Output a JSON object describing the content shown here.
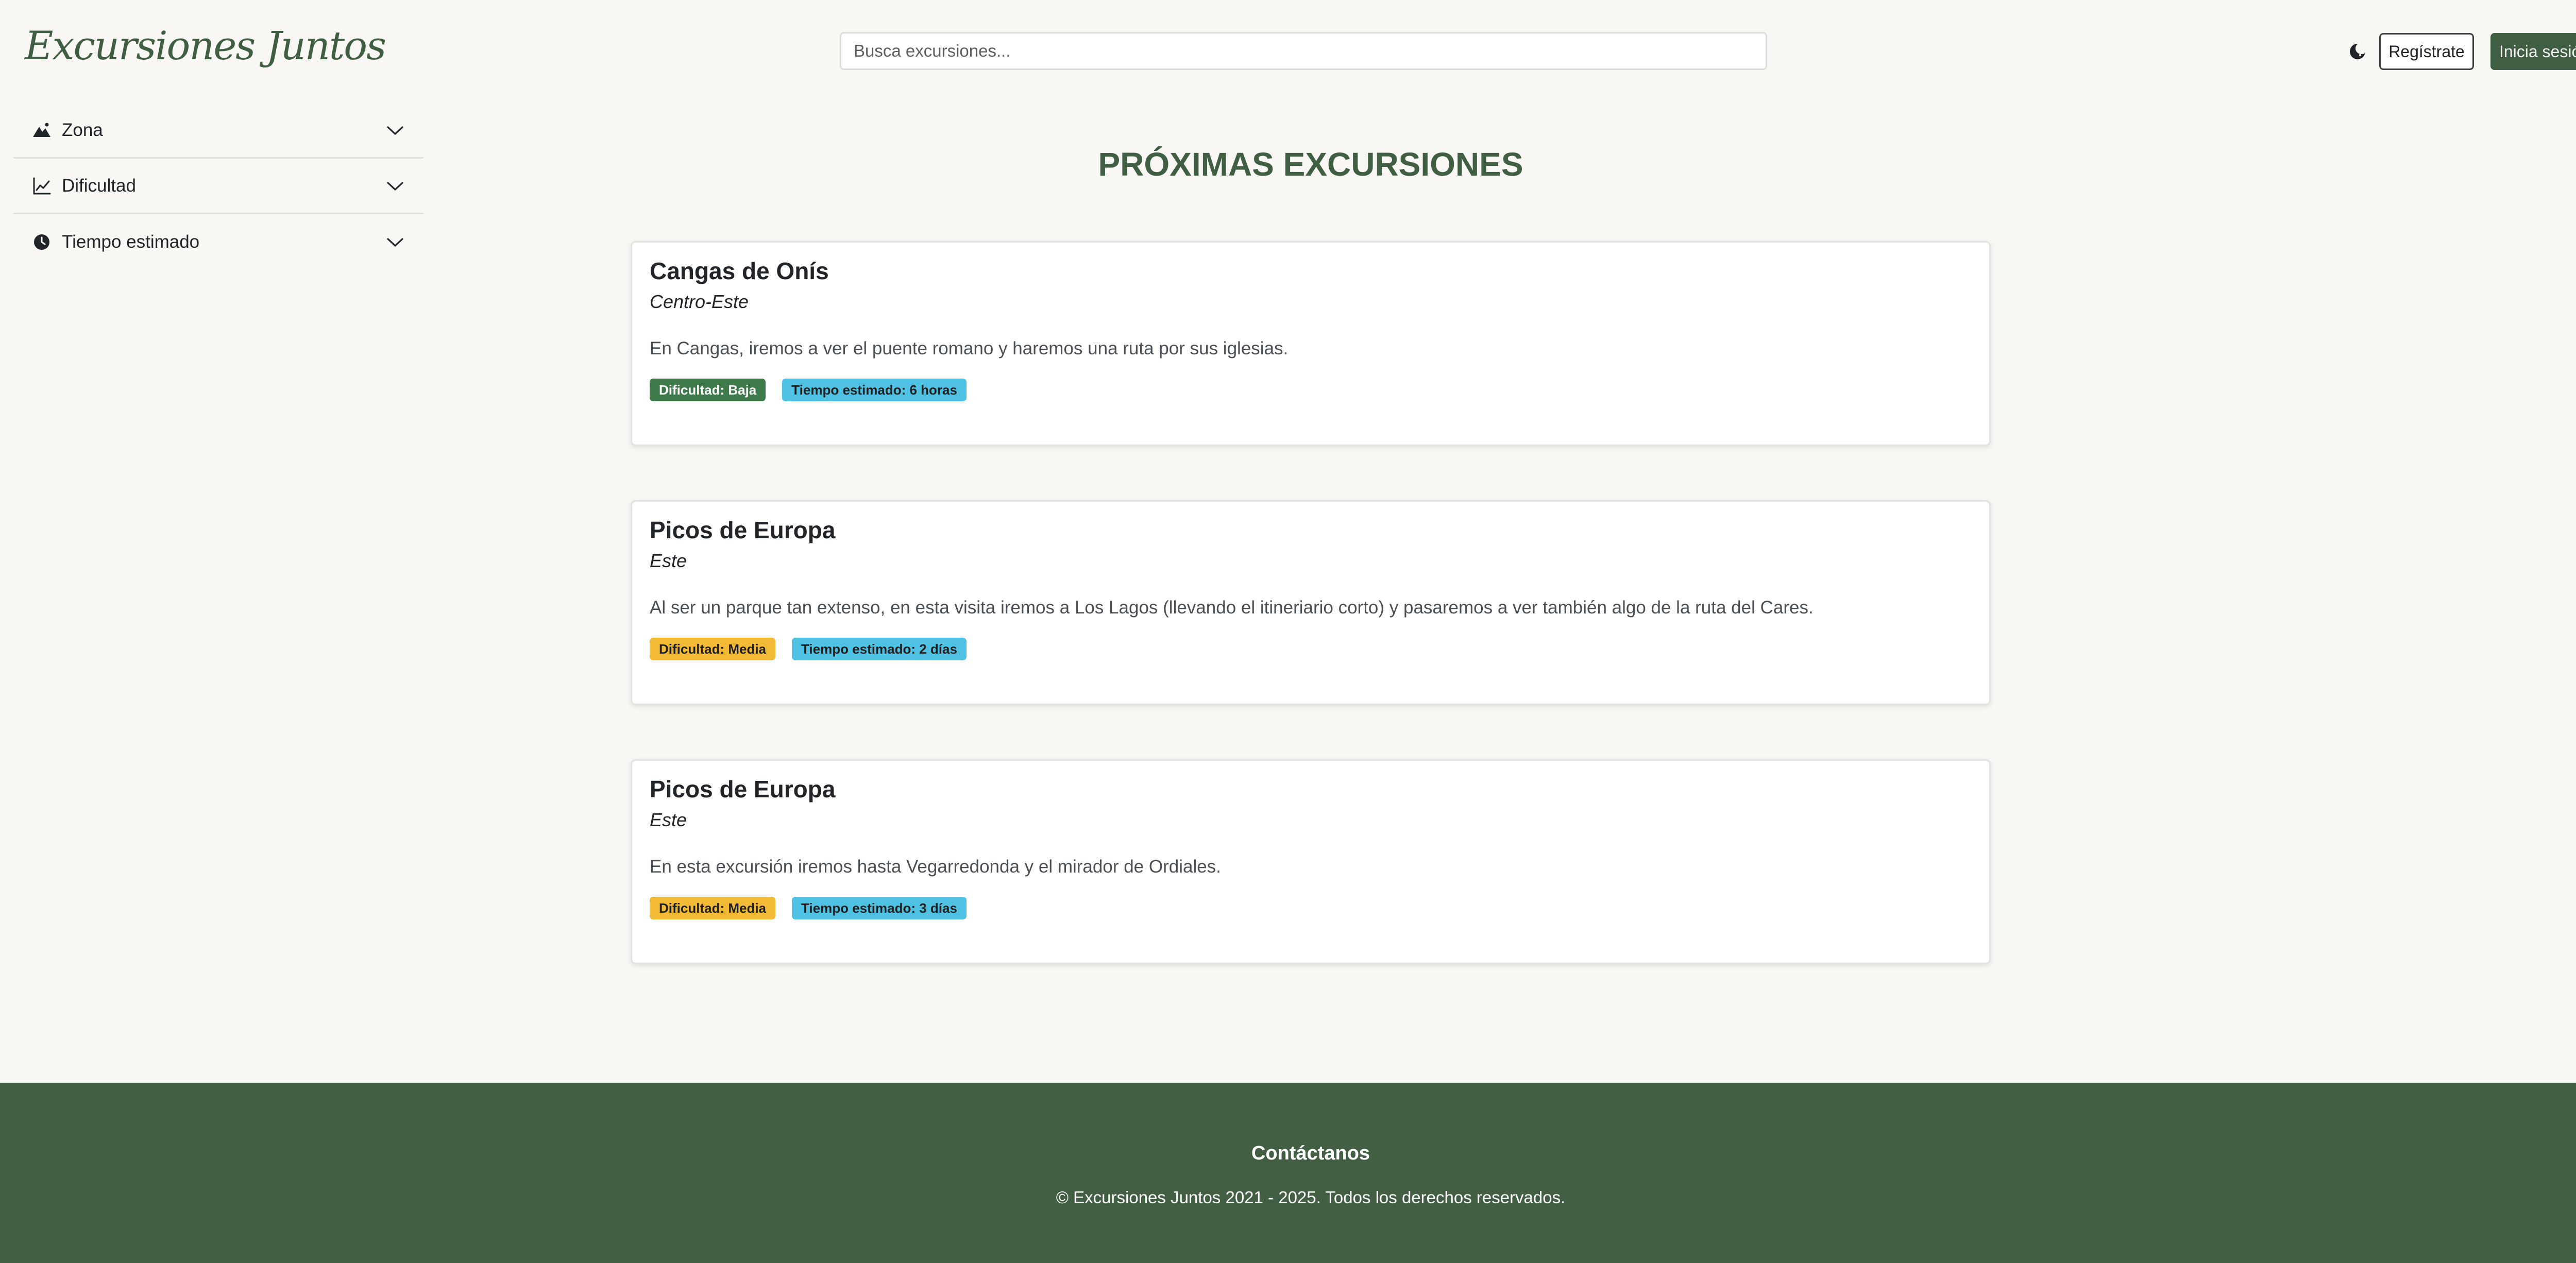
{
  "header": {
    "logo_text": "Excursiones Juntos",
    "search_placeholder": "Busca excursiones...",
    "search_value": "",
    "theme_icon": "moon-icon",
    "register_label": "Regístrate",
    "login_label": "Inicia sesión"
  },
  "sidebar": {
    "filters": [
      {
        "label": "Zona",
        "icon": "mountain-icon"
      },
      {
        "label": "Dificultad",
        "icon": "chart-line-icon"
      },
      {
        "label": "Tiempo estimado",
        "icon": "clock-icon"
      }
    ]
  },
  "main": {
    "title": "PRÓXIMAS EXCURSIONES",
    "cards": [
      {
        "title": "Cangas de Onís",
        "zone": "Centro-Este",
        "description": "En Cangas, iremos a ver el puente romano y haremos una ruta por sus iglesias.",
        "difficulty": "Dificultad: Baja",
        "difficulty_color": "#3f7a4a",
        "time": "Tiempo estimado: 6 horas"
      },
      {
        "title": "Picos de Europa",
        "zone": "Este",
        "description": "Al ser un parque tan extenso, en esta visita iremos a Los Lagos (llevando el itineriario corto) y pasaremos a ver también algo de la ruta del Cares.",
        "difficulty": "Dificultad: Media",
        "difficulty_color": "#f3bb35",
        "time": "Tiempo estimado: 2 días"
      },
      {
        "title": "Picos de Europa",
        "zone": "Este",
        "description": "En esta excursión iremos hasta Vegarredonda y el mirador de Ordiales.",
        "difficulty": "Dificultad: Media",
        "difficulty_color": "#f3bb35",
        "time": "Tiempo estimado: 3 días"
      }
    ]
  },
  "footer": {
    "contact_label": "Contáctanos",
    "copyright": "© Excursiones Juntos 2021 - 2025. Todos los derechos reservados."
  },
  "colors": {
    "brand_green": "#3f5e42",
    "footer_bg": "#425e43",
    "badge_blue": "#4fc1e3"
  }
}
